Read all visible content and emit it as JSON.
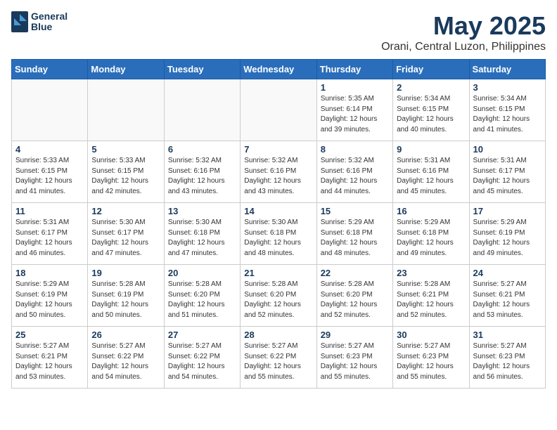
{
  "logo": {
    "line1": "General",
    "line2": "Blue"
  },
  "title": "May 2025",
  "location": "Orani, Central Luzon, Philippines",
  "days_of_week": [
    "Sunday",
    "Monday",
    "Tuesday",
    "Wednesday",
    "Thursday",
    "Friday",
    "Saturday"
  ],
  "weeks": [
    [
      {
        "day": "",
        "info": ""
      },
      {
        "day": "",
        "info": ""
      },
      {
        "day": "",
        "info": ""
      },
      {
        "day": "",
        "info": ""
      },
      {
        "day": "1",
        "info": "Sunrise: 5:35 AM\nSunset: 6:14 PM\nDaylight: 12 hours\nand 39 minutes."
      },
      {
        "day": "2",
        "info": "Sunrise: 5:34 AM\nSunset: 6:15 PM\nDaylight: 12 hours\nand 40 minutes."
      },
      {
        "day": "3",
        "info": "Sunrise: 5:34 AM\nSunset: 6:15 PM\nDaylight: 12 hours\nand 41 minutes."
      }
    ],
    [
      {
        "day": "4",
        "info": "Sunrise: 5:33 AM\nSunset: 6:15 PM\nDaylight: 12 hours\nand 41 minutes."
      },
      {
        "day": "5",
        "info": "Sunrise: 5:33 AM\nSunset: 6:15 PM\nDaylight: 12 hours\nand 42 minutes."
      },
      {
        "day": "6",
        "info": "Sunrise: 5:32 AM\nSunset: 6:16 PM\nDaylight: 12 hours\nand 43 minutes."
      },
      {
        "day": "7",
        "info": "Sunrise: 5:32 AM\nSunset: 6:16 PM\nDaylight: 12 hours\nand 43 minutes."
      },
      {
        "day": "8",
        "info": "Sunrise: 5:32 AM\nSunset: 6:16 PM\nDaylight: 12 hours\nand 44 minutes."
      },
      {
        "day": "9",
        "info": "Sunrise: 5:31 AM\nSunset: 6:16 PM\nDaylight: 12 hours\nand 45 minutes."
      },
      {
        "day": "10",
        "info": "Sunrise: 5:31 AM\nSunset: 6:17 PM\nDaylight: 12 hours\nand 45 minutes."
      }
    ],
    [
      {
        "day": "11",
        "info": "Sunrise: 5:31 AM\nSunset: 6:17 PM\nDaylight: 12 hours\nand 46 minutes."
      },
      {
        "day": "12",
        "info": "Sunrise: 5:30 AM\nSunset: 6:17 PM\nDaylight: 12 hours\nand 47 minutes."
      },
      {
        "day": "13",
        "info": "Sunrise: 5:30 AM\nSunset: 6:18 PM\nDaylight: 12 hours\nand 47 minutes."
      },
      {
        "day": "14",
        "info": "Sunrise: 5:30 AM\nSunset: 6:18 PM\nDaylight: 12 hours\nand 48 minutes."
      },
      {
        "day": "15",
        "info": "Sunrise: 5:29 AM\nSunset: 6:18 PM\nDaylight: 12 hours\nand 48 minutes."
      },
      {
        "day": "16",
        "info": "Sunrise: 5:29 AM\nSunset: 6:18 PM\nDaylight: 12 hours\nand 49 minutes."
      },
      {
        "day": "17",
        "info": "Sunrise: 5:29 AM\nSunset: 6:19 PM\nDaylight: 12 hours\nand 49 minutes."
      }
    ],
    [
      {
        "day": "18",
        "info": "Sunrise: 5:29 AM\nSunset: 6:19 PM\nDaylight: 12 hours\nand 50 minutes."
      },
      {
        "day": "19",
        "info": "Sunrise: 5:28 AM\nSunset: 6:19 PM\nDaylight: 12 hours\nand 50 minutes."
      },
      {
        "day": "20",
        "info": "Sunrise: 5:28 AM\nSunset: 6:20 PM\nDaylight: 12 hours\nand 51 minutes."
      },
      {
        "day": "21",
        "info": "Sunrise: 5:28 AM\nSunset: 6:20 PM\nDaylight: 12 hours\nand 52 minutes."
      },
      {
        "day": "22",
        "info": "Sunrise: 5:28 AM\nSunset: 6:20 PM\nDaylight: 12 hours\nand 52 minutes."
      },
      {
        "day": "23",
        "info": "Sunrise: 5:28 AM\nSunset: 6:21 PM\nDaylight: 12 hours\nand 52 minutes."
      },
      {
        "day": "24",
        "info": "Sunrise: 5:27 AM\nSunset: 6:21 PM\nDaylight: 12 hours\nand 53 minutes."
      }
    ],
    [
      {
        "day": "25",
        "info": "Sunrise: 5:27 AM\nSunset: 6:21 PM\nDaylight: 12 hours\nand 53 minutes."
      },
      {
        "day": "26",
        "info": "Sunrise: 5:27 AM\nSunset: 6:22 PM\nDaylight: 12 hours\nand 54 minutes."
      },
      {
        "day": "27",
        "info": "Sunrise: 5:27 AM\nSunset: 6:22 PM\nDaylight: 12 hours\nand 54 minutes."
      },
      {
        "day": "28",
        "info": "Sunrise: 5:27 AM\nSunset: 6:22 PM\nDaylight: 12 hours\nand 55 minutes."
      },
      {
        "day": "29",
        "info": "Sunrise: 5:27 AM\nSunset: 6:23 PM\nDaylight: 12 hours\nand 55 minutes."
      },
      {
        "day": "30",
        "info": "Sunrise: 5:27 AM\nSunset: 6:23 PM\nDaylight: 12 hours\nand 55 minutes."
      },
      {
        "day": "31",
        "info": "Sunrise: 5:27 AM\nSunset: 6:23 PM\nDaylight: 12 hours\nand 56 minutes."
      }
    ]
  ]
}
